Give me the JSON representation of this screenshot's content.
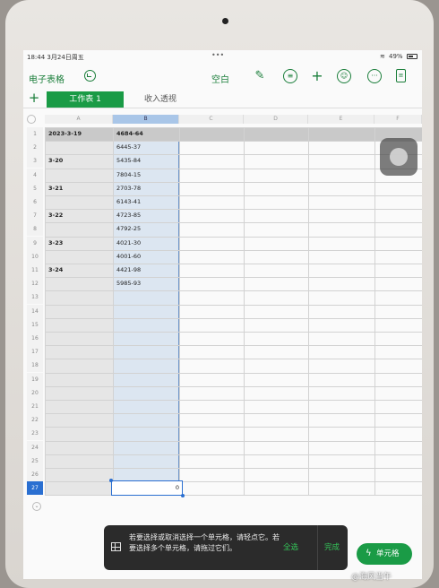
{
  "status_bar": {
    "time": "18:44",
    "date": "3月24日周五",
    "dots": "•••",
    "battery": "49%"
  },
  "toolbar": {
    "app_title": "电子表格",
    "mode_label": "空白",
    "icons": [
      "undo-icon",
      "format-brush-icon",
      "comment-icon",
      "add-icon",
      "collaborate-icon",
      "more-icon",
      "document-icon"
    ]
  },
  "tabs": {
    "add": "+",
    "active": "工作表 1",
    "inactive": "收入透视"
  },
  "columns": [
    "A",
    "B",
    "C",
    "D",
    "E",
    "F"
  ],
  "rows": [
    "1",
    "2",
    "3",
    "4",
    "5",
    "6",
    "7",
    "8",
    "9",
    "10",
    "11",
    "12",
    "13",
    "14",
    "15",
    "16",
    "17",
    "18",
    "19",
    "20",
    "21",
    "22",
    "23",
    "24",
    "25",
    "26",
    "27"
  ],
  "cells": {
    "A": [
      {
        "row": 1,
        "text": "2023-3-19"
      },
      {
        "row": 3,
        "text": "3-20"
      },
      {
        "row": 5,
        "text": "3-21"
      },
      {
        "row": 7,
        "text": "3-22"
      },
      {
        "row": 9,
        "text": "3-23"
      },
      {
        "row": 11,
        "text": "3-24"
      }
    ],
    "B": [
      {
        "row": 1,
        "text": "4684-64"
      },
      {
        "row": 2,
        "text": "6445-37"
      },
      {
        "row": 3,
        "text": "5435-84"
      },
      {
        "row": 4,
        "text": "7804-15"
      },
      {
        "row": 5,
        "text": "2703-78"
      },
      {
        "row": 6,
        "text": "6143-41"
      },
      {
        "row": 7,
        "text": "4723-85"
      },
      {
        "row": 8,
        "text": "4792-25"
      },
      {
        "row": 9,
        "text": "4021-30"
      },
      {
        "row": 10,
        "text": "4001-60"
      },
      {
        "row": 11,
        "text": "4421-98"
      },
      {
        "row": 12,
        "text": "5985-93"
      }
    ]
  },
  "selected_cell": {
    "column": "B",
    "row": 27,
    "value": "0"
  },
  "hint": {
    "message": "若要选择或取消选择一个单元格，请轻点它。若要选择多个单元格，请拖过它们。",
    "select_all": "全选",
    "done": "完成"
  },
  "cell_button": {
    "label": "单元格"
  },
  "watermark": "@海风当午",
  "colors": {
    "accent": "#1a9b46",
    "selection": "#2a6fd1",
    "column_highlight": "#dce6f1"
  }
}
